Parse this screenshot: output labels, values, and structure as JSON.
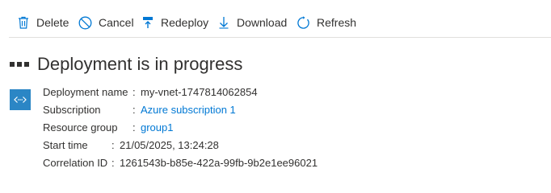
{
  "toolbar": {
    "delete_label": "Delete",
    "cancel_label": "Cancel",
    "redeploy_label": "Redeploy",
    "download_label": "Download",
    "refresh_label": "Refresh"
  },
  "header": {
    "title": "Deployment is in progress"
  },
  "details": {
    "deployment_name_label": "Deployment name",
    "deployment_name_value": "my-vnet-1747814062854",
    "subscription_label": "Subscription",
    "subscription_value": "Azure subscription 1",
    "resource_group_label": "Resource group",
    "resource_group_value": "group1",
    "start_time_label": "Start time",
    "start_time_value": "21/05/2025, 13:24:28",
    "correlation_id_label": "Correlation ID",
    "correlation_id_value": "1261543b-b85e-422a-99fb-9b2e1ee96021",
    "separator": ":"
  },
  "colors": {
    "accent": "#0078d4",
    "icon_box": "#2b86c5",
    "text": "#323130",
    "divider": "#e1dfdd"
  },
  "icons": {
    "delete": "trash-icon",
    "cancel": "cancel-icon",
    "redeploy": "redeploy-icon",
    "download": "download-icon",
    "refresh": "refresh-icon",
    "deployment": "deployment-icon"
  }
}
